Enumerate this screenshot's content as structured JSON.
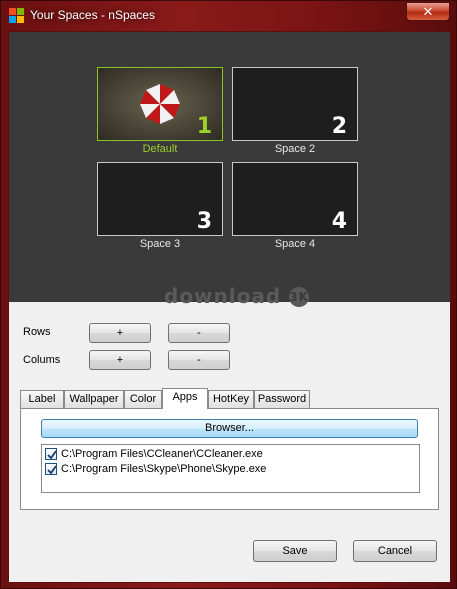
{
  "window": {
    "title": "Your Spaces - nSpaces",
    "close_glyph": "✕"
  },
  "spaces": [
    {
      "number": "1",
      "label": "Default",
      "active": true
    },
    {
      "number": "2",
      "label": "Space 2",
      "active": false
    },
    {
      "number": "3",
      "label": "Space 3",
      "active": false
    },
    {
      "number": "4",
      "label": "Space 4",
      "active": false
    }
  ],
  "watermark": {
    "text": "download",
    "badge": "3K"
  },
  "grid_controls": {
    "rows_label": "Rows",
    "columns_label": "Colums",
    "plus": "+",
    "minus": "-"
  },
  "tabs": [
    {
      "label": "Label"
    },
    {
      "label": "Wallpaper"
    },
    {
      "label": "Color"
    },
    {
      "label": "Apps",
      "selected": true
    },
    {
      "label": "HotKey"
    },
    {
      "label": "Password"
    }
  ],
  "apps_tab": {
    "browse_label": "Browser...",
    "files": [
      {
        "path": "C:\\Program Files\\CCleaner\\CCleaner.exe",
        "checked": true
      },
      {
        "path": "C:\\Program Files\\Skype\\Phone\\Skype.exe",
        "checked": true
      }
    ]
  },
  "footer": {
    "save_label": "Save",
    "cancel_label": "Cancel"
  },
  "colors": {
    "accent": "#9ed02a",
    "title_bar": "#8a1a1a",
    "panel": "#3a3a3a"
  }
}
